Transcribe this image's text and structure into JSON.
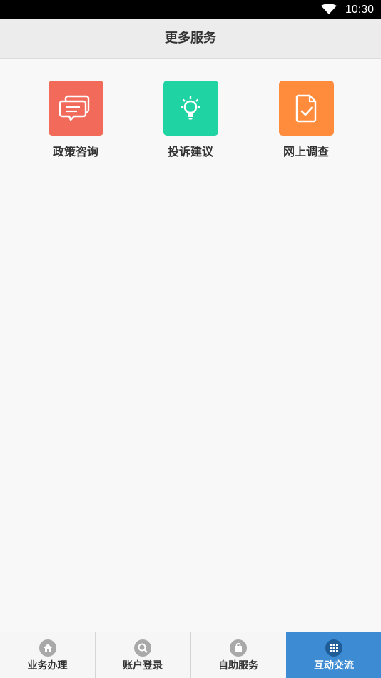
{
  "status_bar": {
    "time": "10:30",
    "wifi_icon": "wifi-icon"
  },
  "header": {
    "title": "更多服务",
    "background": "#ececec"
  },
  "services": [
    {
      "label": "政策咨询",
      "icon": "chat-bubbles-icon",
      "color": "#f26b5a"
    },
    {
      "label": "投诉建议",
      "icon": "lightbulb-icon",
      "color": "#1fd3a2"
    },
    {
      "label": "网上调查",
      "icon": "survey-document-icon",
      "color": "#ff8b3d"
    }
  ],
  "tabs": [
    {
      "label": "业务办理",
      "icon": "home-icon",
      "active": false
    },
    {
      "label": "账户登录",
      "icon": "search-icon",
      "active": false
    },
    {
      "label": "自助服务",
      "icon": "bag-icon",
      "active": false
    },
    {
      "label": "互动交流",
      "icon": "grid-icon",
      "active": true
    }
  ],
  "colors": {
    "tab_active_bg": "#3d8bd3",
    "tab_inactive_bg": "#f6f6f6"
  }
}
